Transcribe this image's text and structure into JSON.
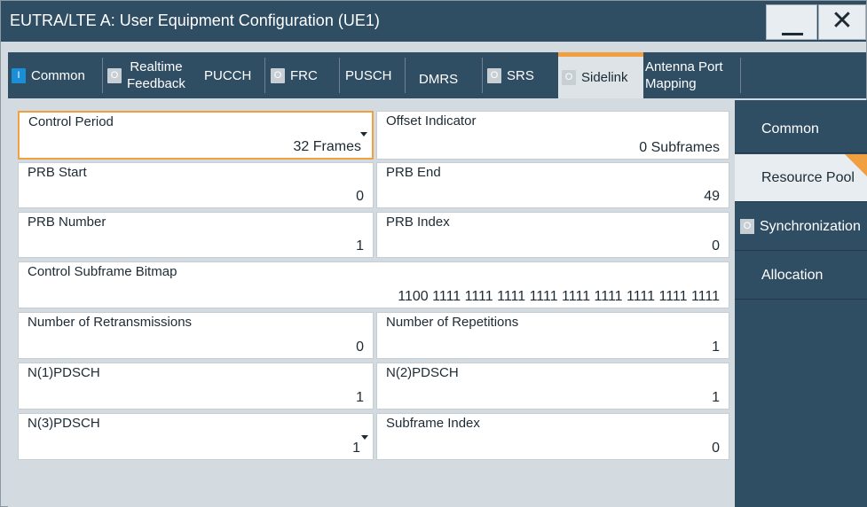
{
  "window": {
    "title": "EUTRA/LTE A: User Equipment Configuration (UE1)",
    "minimize_label": "",
    "close_label": "✕"
  },
  "tabs": [
    {
      "label": "Common",
      "indicator": "I",
      "indicator_state": "on"
    },
    {
      "label_line1": "Realtime",
      "label_line2": "Feedback",
      "indicator": "O",
      "indicator_state": "off"
    },
    {
      "label": "PUCCH"
    },
    {
      "label": "FRC",
      "indicator": "O",
      "indicator_state": "off"
    },
    {
      "label": "PUSCH"
    },
    {
      "label": "DMRS"
    },
    {
      "label": "SRS",
      "indicator": "O",
      "indicator_state": "off"
    },
    {
      "label": "Sidelink",
      "indicator": "O",
      "indicator_state": "off",
      "active": true
    },
    {
      "label_line1": "Antenna Port",
      "label_line2": "Mapping"
    }
  ],
  "fields": {
    "control_period": {
      "label": "Control Period",
      "value": "32 Frames"
    },
    "offset_indicator": {
      "label": "Offset Indicator",
      "value": "0 Subframes"
    },
    "prb_start": {
      "label": "PRB Start",
      "value": "0"
    },
    "prb_end": {
      "label": "PRB End",
      "value": "49"
    },
    "prb_number": {
      "label": "PRB Number",
      "value": "1"
    },
    "prb_index": {
      "label": "PRB Index",
      "value": "0"
    },
    "control_subframe_bitmap": {
      "label": "Control Subframe Bitmap",
      "value": "1100 1111 1111 1111 1111 1111 1111 1111 1111 1111"
    },
    "num_retransmissions": {
      "label": "Number of Retransmissions",
      "value": "0"
    },
    "num_repetitions": {
      "label": "Number of Repetitions",
      "value": "1"
    },
    "n1_pdsch": {
      "label": "N(1)PDSCH",
      "value": "1"
    },
    "n2_pdsch": {
      "label": "N(2)PDSCH",
      "value": "1"
    },
    "n3_pdsch": {
      "label": "N(3)PDSCH",
      "value": "1"
    },
    "subframe_index": {
      "label": "Subframe Index",
      "value": "0"
    }
  },
  "sidenav": [
    {
      "label": "Common"
    },
    {
      "label": "Resource Pool",
      "active": true
    },
    {
      "label": "Synchronization",
      "indicator": "O"
    },
    {
      "label": "Allocation"
    }
  ],
  "colors": {
    "header_bg": "#2f4d63",
    "accent": "#f0a040",
    "active_indicator": "#1a8fd8",
    "panel_bg": "#d3dbe1"
  }
}
